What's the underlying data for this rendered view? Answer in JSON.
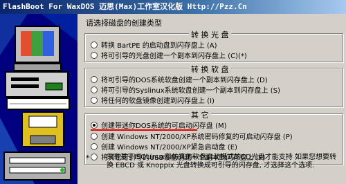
{
  "window": {
    "title": "FlashBoot For WaxDOS 迈思(Max)工作室汉化版 Http://Pzz.Cn"
  },
  "intro": "请选择磁盘的创建类型",
  "groups": [
    {
      "label": "转 换 光 盘",
      "options": [
        {
          "label": "转换 BartPE 的启动盘到闪存盘上 (A)",
          "selected": false
        },
        {
          "label": "将可引导的光盘创建一个副本到闪存盘上 (C)(*)",
          "selected": false
        }
      ]
    },
    {
      "label": "转 换 软 盘",
      "options": [
        {
          "label": "将可引导的DOS系统软盘创建一个副本到闪存盘上 (D)",
          "selected": false
        },
        {
          "label": "将可引导的Syslinux系统软盘创建一个副本到闪存盘上 (S)",
          "selected": false
        },
        {
          "label": "将任何的软盘镜像创建到闪存盘上 (I)",
          "selected": false
        }
      ]
    },
    {
      "label": "其 它",
      "options": [
        {
          "label": "创建带迷你DOS系统的可启动闪存盘 (M)",
          "selected": true
        },
        {
          "label": "创建 Windows NT/2000/XP系统密码修复的可启动闪存盘 (P)",
          "selected": false
        },
        {
          "label": "创建 Windows NT/2000/XP紧急启动盘 (E)",
          "selected": false
        },
        {
          "label": "将其它可引导的USB设备创建一个副本到闪存盘上 (F)",
          "selected": false
        }
      ]
    }
  ],
  "note": {
    "star": "*",
    "text": "只有基于ISOLinux和仿真的软盘启动模式的CD光盘才能支持 如果您想要转换 EBCD 或 Knoppix 光盘转换成可引导的闪存盘, 才选择这个选项."
  },
  "colors": {
    "title_start": "#0a246a",
    "title_end": "#a6caf0",
    "face": "#d4d0c8",
    "art_bg": "#000080",
    "highlight": "#e00000"
  }
}
